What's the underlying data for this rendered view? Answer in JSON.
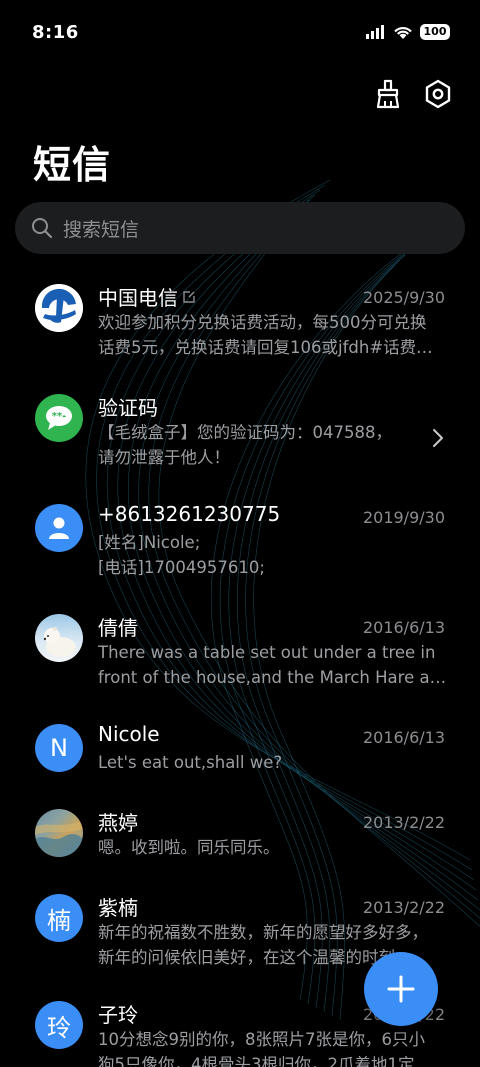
{
  "status": {
    "time": "8:16",
    "battery": "100"
  },
  "header": {
    "title": "短信"
  },
  "search": {
    "placeholder": "搜索短信"
  },
  "conversations": [
    {
      "name": "中国电信",
      "date": "2025/9/30",
      "line1": "欢迎参加积分兑换话费活动，每500分可兑换",
      "line2": "话费5元，兑换话费请回复106或jfdh#话费…",
      "avatar": "telecom-logo",
      "verified_icon": "external-link-icon"
    },
    {
      "name": "验证码",
      "date": "",
      "line1": "【毛绒盒子】您的验证码为：047588，",
      "line2": "请勿泄露于他人！",
      "avatar": "chat-bubble-icon",
      "avatar_color": "#2fb44f"
    },
    {
      "name": "+8613261230775",
      "date": "2019/9/30",
      "line1": "[姓名]Nicole;",
      "line2": "[电话]17004957610;",
      "avatar": "person-icon",
      "avatar_color": "#3b8ef5"
    },
    {
      "name": "倩倩",
      "date": "2016/6/13",
      "line1": "There was a table set out under a tree in",
      "line2": "front of the house,and the March Hare an…",
      "avatar": "polar-bear-photo"
    },
    {
      "name": "Nicole",
      "date": "2016/6/13",
      "line1": "Let's eat out,shall we?",
      "line2": "",
      "avatar_letter": "N",
      "avatar_color": "#3b8ef5"
    },
    {
      "name": "燕婷",
      "date": "2013/2/22",
      "line1": "嗯。收到啦。同乐同乐。",
      "line2": "",
      "avatar": "landscape-photo"
    },
    {
      "name": "紫楠",
      "date": "2013/2/22",
      "line1": "新年的祝福数不胜数，新年的愿望好多好多，",
      "line2": "新年的问候依旧美好，在这个温馨的时刻…",
      "avatar_letter": "楠",
      "avatar_color": "#3b8ef5"
    },
    {
      "name": "子玲",
      "date": "2013/2/22",
      "line1": "10分想念9别的你，8张照片7张是你，6只小",
      "line2": "狗5只像你，4根骨头3根归你，2爪着地1定",
      "avatar_letter": "玲",
      "avatar_color": "#3b8ef5"
    }
  ],
  "colors": {
    "accent": "#3b8ef5",
    "background": "#000000",
    "secondary_text": "#9d9ea2"
  }
}
